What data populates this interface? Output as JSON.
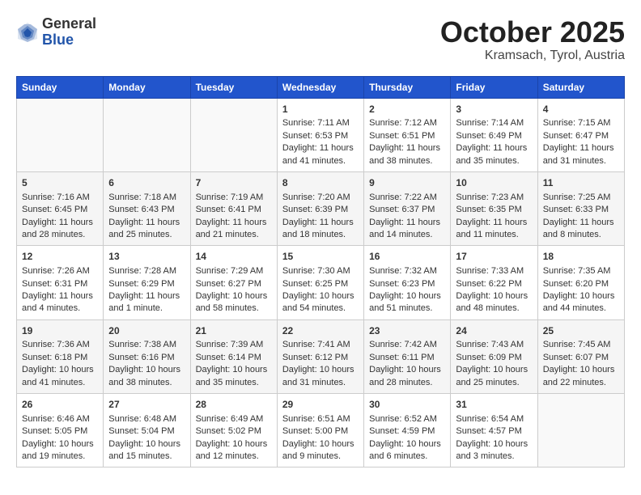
{
  "header": {
    "logo": {
      "line1": "General",
      "line2": "Blue"
    },
    "month": "October 2025",
    "location": "Kramsach, Tyrol, Austria"
  },
  "days_of_week": [
    "Sunday",
    "Monday",
    "Tuesday",
    "Wednesday",
    "Thursday",
    "Friday",
    "Saturday"
  ],
  "weeks": [
    [
      {
        "day": "",
        "content": ""
      },
      {
        "day": "",
        "content": ""
      },
      {
        "day": "",
        "content": ""
      },
      {
        "day": "1",
        "content": "Sunrise: 7:11 AM\nSunset: 6:53 PM\nDaylight: 11 hours and 41 minutes."
      },
      {
        "day": "2",
        "content": "Sunrise: 7:12 AM\nSunset: 6:51 PM\nDaylight: 11 hours and 38 minutes."
      },
      {
        "day": "3",
        "content": "Sunrise: 7:14 AM\nSunset: 6:49 PM\nDaylight: 11 hours and 35 minutes."
      },
      {
        "day": "4",
        "content": "Sunrise: 7:15 AM\nSunset: 6:47 PM\nDaylight: 11 hours and 31 minutes."
      }
    ],
    [
      {
        "day": "5",
        "content": "Sunrise: 7:16 AM\nSunset: 6:45 PM\nDaylight: 11 hours and 28 minutes."
      },
      {
        "day": "6",
        "content": "Sunrise: 7:18 AM\nSunset: 6:43 PM\nDaylight: 11 hours and 25 minutes."
      },
      {
        "day": "7",
        "content": "Sunrise: 7:19 AM\nSunset: 6:41 PM\nDaylight: 11 hours and 21 minutes."
      },
      {
        "day": "8",
        "content": "Sunrise: 7:20 AM\nSunset: 6:39 PM\nDaylight: 11 hours and 18 minutes."
      },
      {
        "day": "9",
        "content": "Sunrise: 7:22 AM\nSunset: 6:37 PM\nDaylight: 11 hours and 14 minutes."
      },
      {
        "day": "10",
        "content": "Sunrise: 7:23 AM\nSunset: 6:35 PM\nDaylight: 11 hours and 11 minutes."
      },
      {
        "day": "11",
        "content": "Sunrise: 7:25 AM\nSunset: 6:33 PM\nDaylight: 11 hours and 8 minutes."
      }
    ],
    [
      {
        "day": "12",
        "content": "Sunrise: 7:26 AM\nSunset: 6:31 PM\nDaylight: 11 hours and 4 minutes."
      },
      {
        "day": "13",
        "content": "Sunrise: 7:28 AM\nSunset: 6:29 PM\nDaylight: 11 hours and 1 minute."
      },
      {
        "day": "14",
        "content": "Sunrise: 7:29 AM\nSunset: 6:27 PM\nDaylight: 10 hours and 58 minutes."
      },
      {
        "day": "15",
        "content": "Sunrise: 7:30 AM\nSunset: 6:25 PM\nDaylight: 10 hours and 54 minutes."
      },
      {
        "day": "16",
        "content": "Sunrise: 7:32 AM\nSunset: 6:23 PM\nDaylight: 10 hours and 51 minutes."
      },
      {
        "day": "17",
        "content": "Sunrise: 7:33 AM\nSunset: 6:22 PM\nDaylight: 10 hours and 48 minutes."
      },
      {
        "day": "18",
        "content": "Sunrise: 7:35 AM\nSunset: 6:20 PM\nDaylight: 10 hours and 44 minutes."
      }
    ],
    [
      {
        "day": "19",
        "content": "Sunrise: 7:36 AM\nSunset: 6:18 PM\nDaylight: 10 hours and 41 minutes."
      },
      {
        "day": "20",
        "content": "Sunrise: 7:38 AM\nSunset: 6:16 PM\nDaylight: 10 hours and 38 minutes."
      },
      {
        "day": "21",
        "content": "Sunrise: 7:39 AM\nSunset: 6:14 PM\nDaylight: 10 hours and 35 minutes."
      },
      {
        "day": "22",
        "content": "Sunrise: 7:41 AM\nSunset: 6:12 PM\nDaylight: 10 hours and 31 minutes."
      },
      {
        "day": "23",
        "content": "Sunrise: 7:42 AM\nSunset: 6:11 PM\nDaylight: 10 hours and 28 minutes."
      },
      {
        "day": "24",
        "content": "Sunrise: 7:43 AM\nSunset: 6:09 PM\nDaylight: 10 hours and 25 minutes."
      },
      {
        "day": "25",
        "content": "Sunrise: 7:45 AM\nSunset: 6:07 PM\nDaylight: 10 hours and 22 minutes."
      }
    ],
    [
      {
        "day": "26",
        "content": "Sunrise: 6:46 AM\nSunset: 5:05 PM\nDaylight: 10 hours and 19 minutes."
      },
      {
        "day": "27",
        "content": "Sunrise: 6:48 AM\nSunset: 5:04 PM\nDaylight: 10 hours and 15 minutes."
      },
      {
        "day": "28",
        "content": "Sunrise: 6:49 AM\nSunset: 5:02 PM\nDaylight: 10 hours and 12 minutes."
      },
      {
        "day": "29",
        "content": "Sunrise: 6:51 AM\nSunset: 5:00 PM\nDaylight: 10 hours and 9 minutes."
      },
      {
        "day": "30",
        "content": "Sunrise: 6:52 AM\nSunset: 4:59 PM\nDaylight: 10 hours and 6 minutes."
      },
      {
        "day": "31",
        "content": "Sunrise: 6:54 AM\nSunset: 4:57 PM\nDaylight: 10 hours and 3 minutes."
      },
      {
        "day": "",
        "content": ""
      }
    ]
  ]
}
